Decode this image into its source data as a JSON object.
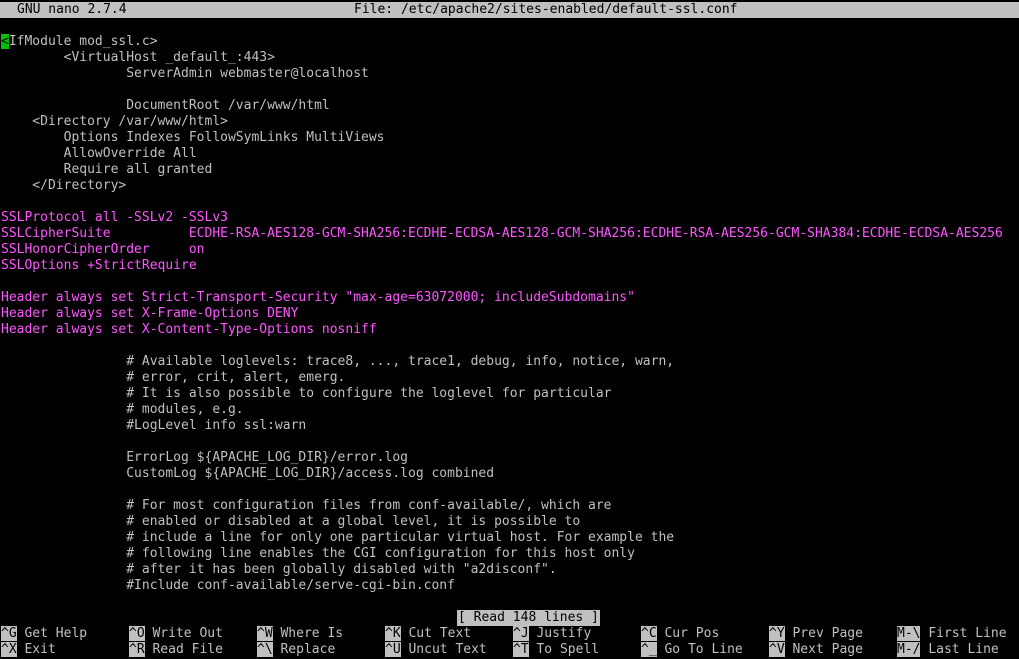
{
  "titlebar": {
    "app": "GNU nano 2.7.4",
    "file": "File: /etc/apache2/sites-enabled/default-ssl.conf"
  },
  "editor": {
    "cursor_char": "<",
    "lines": [
      {
        "text": "IfModule mod_ssl.c>",
        "style": "normal",
        "cursor": true
      },
      {
        "text": "        <VirtualHost _default_:443>",
        "style": "normal"
      },
      {
        "text": "                ServerAdmin webmaster@localhost",
        "style": "normal"
      },
      {
        "text": "",
        "style": "normal"
      },
      {
        "text": "                DocumentRoot /var/www/html",
        "style": "normal"
      },
      {
        "text": "    <Directory /var/www/html>",
        "style": "normal"
      },
      {
        "text": "        Options Indexes FollowSymLinks MultiViews",
        "style": "normal"
      },
      {
        "text": "        AllowOverride All",
        "style": "normal"
      },
      {
        "text": "        Require all granted",
        "style": "normal"
      },
      {
        "text": "    </Directory>",
        "style": "normal"
      },
      {
        "text": "",
        "style": "normal"
      },
      {
        "text": "SSLProtocol all -SSLv2 -SSLv3",
        "style": "mag"
      },
      {
        "text": "SSLCipherSuite          ECDHE-RSA-AES128-GCM-SHA256:ECDHE-ECDSA-AES128-GCM-SHA256:ECDHE-RSA-AES256-GCM-SHA384:ECDHE-ECDSA-AES256",
        "style": "mag"
      },
      {
        "text": "SSLHonorCipherOrder     on",
        "style": "mag"
      },
      {
        "text": "SSLOptions +StrictRequire",
        "style": "mag"
      },
      {
        "text": "",
        "style": "normal"
      },
      {
        "text": "Header always set Strict-Transport-Security \"max-age=63072000; includeSubdomains\"",
        "style": "mag"
      },
      {
        "text": "Header always set X-Frame-Options DENY",
        "style": "mag"
      },
      {
        "text": "Header always set X-Content-Type-Options nosniff",
        "style": "mag"
      },
      {
        "text": "",
        "style": "normal"
      },
      {
        "text": "                # Available loglevels: trace8, ..., trace1, debug, info, notice, warn,",
        "style": "normal"
      },
      {
        "text": "                # error, crit, alert, emerg.",
        "style": "normal"
      },
      {
        "text": "                # It is also possible to configure the loglevel for particular",
        "style": "normal"
      },
      {
        "text": "                # modules, e.g.",
        "style": "normal"
      },
      {
        "text": "                #LogLevel info ssl:warn",
        "style": "normal"
      },
      {
        "text": "",
        "style": "normal"
      },
      {
        "text": "                ErrorLog ${APACHE_LOG_DIR}/error.log",
        "style": "normal"
      },
      {
        "text": "                CustomLog ${APACHE_LOG_DIR}/access.log combined",
        "style": "normal"
      },
      {
        "text": "",
        "style": "normal"
      },
      {
        "text": "                # For most configuration files from conf-available/, which are",
        "style": "normal"
      },
      {
        "text": "                # enabled or disabled at a global level, it is possible to",
        "style": "normal"
      },
      {
        "text": "                # include a line for only one particular virtual host. For example the",
        "style": "normal"
      },
      {
        "text": "                # following line enables the CGI configuration for this host only",
        "style": "normal"
      },
      {
        "text": "                # after it has been globally disabled with \"a2disconf\".",
        "style": "normal"
      },
      {
        "text": "                #Include conf-available/serve-cgi-bin.conf",
        "style": "normal"
      }
    ]
  },
  "status": "[ Read 148 lines ]",
  "shortcuts": [
    {
      "key": "^G",
      "label": "Get Help"
    },
    {
      "key": "^O",
      "label": "Write Out"
    },
    {
      "key": "^W",
      "label": "Where Is"
    },
    {
      "key": "^K",
      "label": "Cut Text"
    },
    {
      "key": "^J",
      "label": "Justify"
    },
    {
      "key": "^C",
      "label": "Cur Pos"
    },
    {
      "key": "^Y",
      "label": "Prev Page"
    },
    {
      "key": "M-\\",
      "label": "First Line"
    },
    {
      "key": "^X",
      "label": "Exit"
    },
    {
      "key": "^R",
      "label": "Read File"
    },
    {
      "key": "^\\",
      "label": "Replace"
    },
    {
      "key": "^U",
      "label": "Uncut Text"
    },
    {
      "key": "^T",
      "label": "To Spell"
    },
    {
      "key": "^_",
      "label": "Go To Line"
    },
    {
      "key": "^V",
      "label": "Next Page"
    },
    {
      "key": "M-/",
      "label": "Last Line"
    }
  ],
  "colors": {
    "foreground": "#c0c0c0",
    "background": "#000000",
    "directive": "#ff55ff",
    "cursor": "#00c000",
    "bar": "#c0c0c0"
  }
}
